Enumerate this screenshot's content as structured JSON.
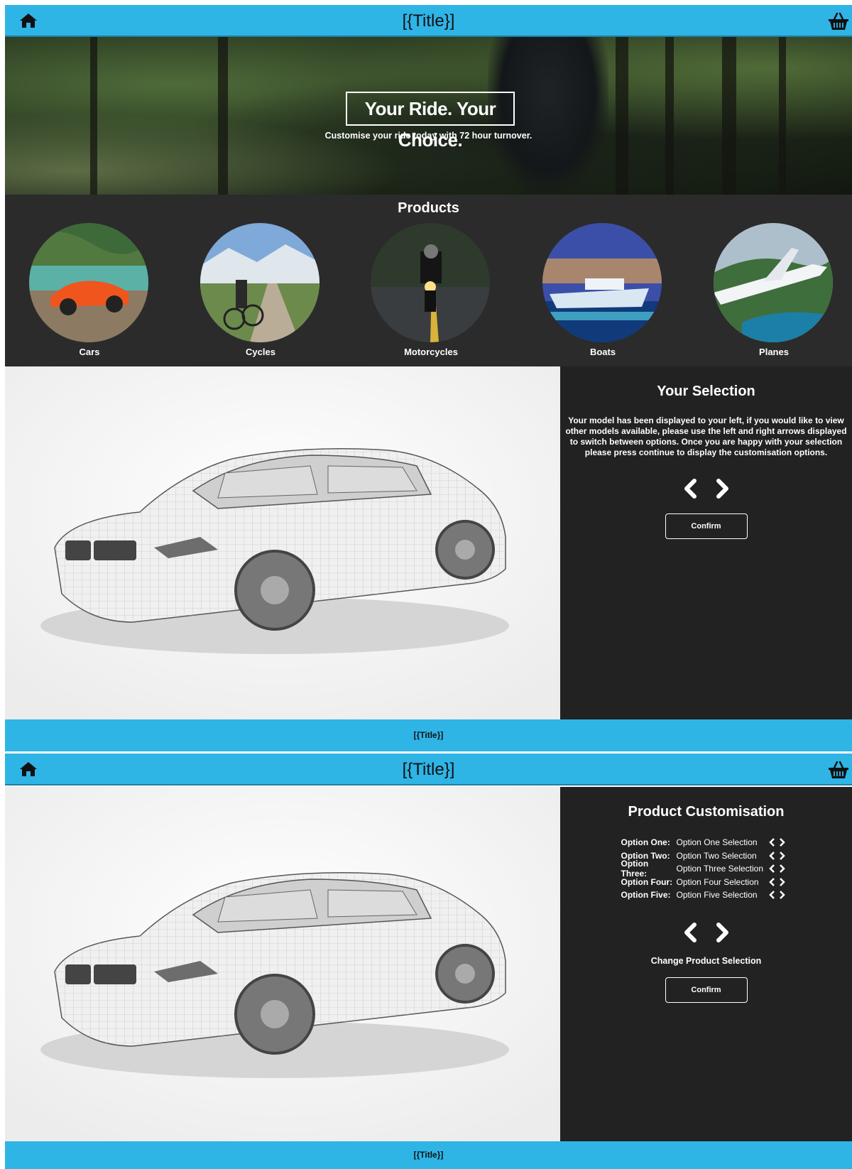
{
  "screen1": {
    "header": {
      "title": "[{Title}]",
      "home_icon": "home-icon",
      "basket_icon": "basket-icon"
    },
    "hero": {
      "heading": "Your Ride. Your Choice.",
      "subheading": "Customise your ride today with 72 hour turnover."
    },
    "products": {
      "title": "Products",
      "items": [
        {
          "label": "Cars"
        },
        {
          "label": "Cycles"
        },
        {
          "label": "Motorcycles"
        },
        {
          "label": "Boats"
        },
        {
          "label": "Planes"
        }
      ]
    },
    "selection": {
      "title": "Your Selection",
      "description": "Your model has been displayed to your left, if you would like to view other models available, please use the left and right arrows displayed to switch between options. Once you are happy with your selection please press continue to display the customisation options.",
      "confirm_label": "Confirm"
    },
    "footer": {
      "title": "[{Title}]"
    }
  },
  "screen2": {
    "header": {
      "title": "[{Title}]"
    },
    "customisation": {
      "title": "Product Customisation",
      "options": [
        {
          "label": "Option One:",
          "value": "Option One Selection"
        },
        {
          "label": "Option Two:",
          "value": "Option Two Selection"
        },
        {
          "label": "Option Three:",
          "value": "Option Three Selection"
        },
        {
          "label": "Option Four:",
          "value": "Option Four Selection"
        },
        {
          "label": "Option Five:",
          "value": "Option Five Selection"
        }
      ],
      "change_label": "Change Product Selection",
      "confirm_label": "Confirm"
    },
    "footer": {
      "title": "[{Title}]"
    }
  },
  "colors": {
    "accent": "#2fb4e6",
    "panel": "#222222",
    "products_bg": "#2b2b2b"
  }
}
